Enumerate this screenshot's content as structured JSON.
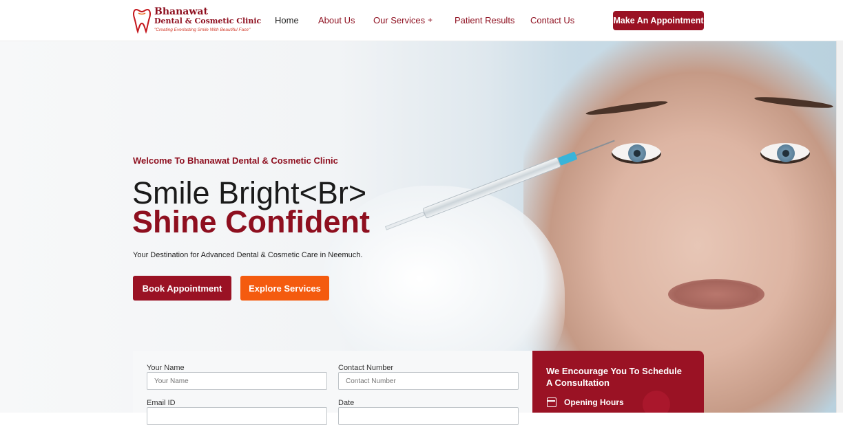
{
  "header": {
    "logo": {
      "name": "Bhanawat",
      "subtitle": "Dental & Cosmetic Clinic",
      "tagline": "\"Creating Everlasting Smile With Beautiful Face\""
    },
    "nav": {
      "home": "Home",
      "about": "About Us",
      "services": "Our Services",
      "services_expand": "+",
      "results": "Patient Results",
      "contact": "Contact Us"
    },
    "cta": "Make An Appointment"
  },
  "hero": {
    "welcome": "Welcome To Bhanawat Dental & Cosmetic Clinic",
    "headline_1": "Smile Bright<Br>",
    "headline_2": "Shine Confident",
    "lead": "Your Destination for Advanced Dental & Cosmetic Care in Neemuch.",
    "book_label": "Book Appointment",
    "explore_label": "Explore Services"
  },
  "form": {
    "name_label": "Your Name",
    "name_placeholder": "Your Name",
    "contact_label": "Contact Number",
    "contact_placeholder": "Contact Number",
    "email_label": "Email ID",
    "date_label": "Date"
  },
  "schedule": {
    "title": "We Encourage You To Schedule A Consultation",
    "hours_label": "Opening Hours"
  },
  "colors": {
    "brand": "#9a1224",
    "accent": "#f45b0f"
  }
}
